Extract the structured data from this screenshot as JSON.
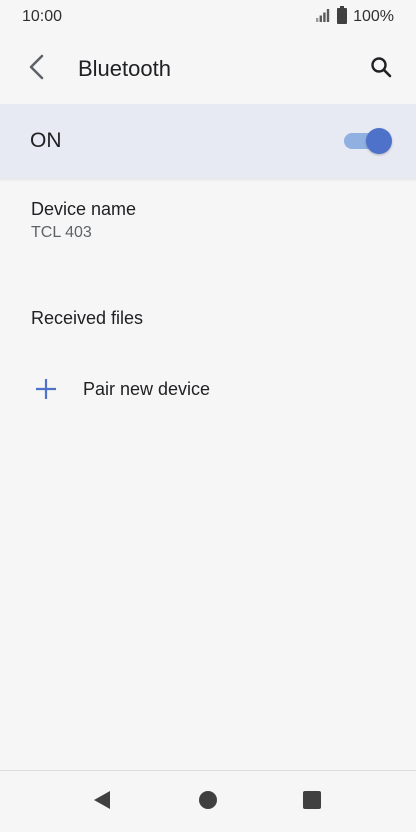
{
  "status_bar": {
    "time": "10:00",
    "battery": "100%",
    "icons": [
      "signal-icon",
      "battery-icon"
    ]
  },
  "app_bar": {
    "title": "Bluetooth",
    "back_icon": "back-arrow-icon",
    "search_icon": "search-icon"
  },
  "master_switch": {
    "label": "ON",
    "state": true
  },
  "list": {
    "device_name": {
      "title": "Device name",
      "summary": "TCL 403"
    },
    "received_files": {
      "title": "Received files"
    },
    "pair_new_device": {
      "title": "Pair new device",
      "icon": "plus-icon"
    }
  },
  "nav_bar": {
    "icons": [
      "back-triangle-icon",
      "home-circle-icon",
      "recents-square-icon"
    ]
  },
  "colors": {
    "background": "#f6f6f6",
    "switch_bar": "#e8eaf3",
    "accent": "#4e72c9",
    "track": "#8fb0e0"
  }
}
